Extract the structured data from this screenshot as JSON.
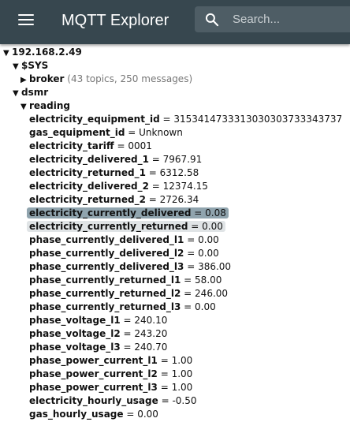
{
  "app": {
    "title": "MQTT Explorer",
    "search_placeholder": "Search...",
    "colors": {
      "topbar": "#37474f",
      "selected": "#90a4ae",
      "hover": "#e0e4e6"
    },
    "icons": {
      "menu": "hamburger-menu-icon",
      "search": "search-icon",
      "expanded": "triangle-down-icon",
      "collapsed": "triangle-right-icon"
    }
  },
  "tree": {
    "root": "192.168.2.49",
    "sys": "$SYS",
    "broker": "broker",
    "broker_meta": "(43 topics, 250 messages)",
    "dsmr": "dsmr",
    "reading": "reading",
    "values": [
      {
        "key": "electricity_equipment_id",
        "value": "3153414733313030303733343737"
      },
      {
        "key": "gas_equipment_id",
        "value": "Unknown"
      },
      {
        "key": "electricity_tariff",
        "value": "0001"
      },
      {
        "key": "electricity_delivered_1",
        "value": "7967.91"
      },
      {
        "key": "electricity_returned_1",
        "value": "6312.58"
      },
      {
        "key": "electricity_delivered_2",
        "value": "12374.15"
      },
      {
        "key": "electricity_returned_2",
        "value": "2726.34"
      },
      {
        "key": "electricity_currently_delivered",
        "value": "0.08"
      },
      {
        "key": "electricity_currently_returned",
        "value": "0.00"
      },
      {
        "key": "phase_currently_delivered_l1",
        "value": "0.00"
      },
      {
        "key": "phase_currently_delivered_l2",
        "value": "0.00"
      },
      {
        "key": "phase_currently_delivered_l3",
        "value": "386.00"
      },
      {
        "key": "phase_currently_returned_l1",
        "value": "58.00"
      },
      {
        "key": "phase_currently_returned_l2",
        "value": "246.00"
      },
      {
        "key": "phase_currently_returned_l3",
        "value": "0.00"
      },
      {
        "key": "phase_voltage_l1",
        "value": "240.10"
      },
      {
        "key": "phase_voltage_l2",
        "value": "243.20"
      },
      {
        "key": "phase_voltage_l3",
        "value": "240.70"
      },
      {
        "key": "phase_power_current_l1",
        "value": "1.00"
      },
      {
        "key": "phase_power_current_l2",
        "value": "1.00"
      },
      {
        "key": "phase_power_current_l3",
        "value": "1.00"
      },
      {
        "key": "electricity_hourly_usage",
        "value": "-0.50"
      },
      {
        "key": "gas_hourly_usage",
        "value": "0.00"
      }
    ]
  }
}
